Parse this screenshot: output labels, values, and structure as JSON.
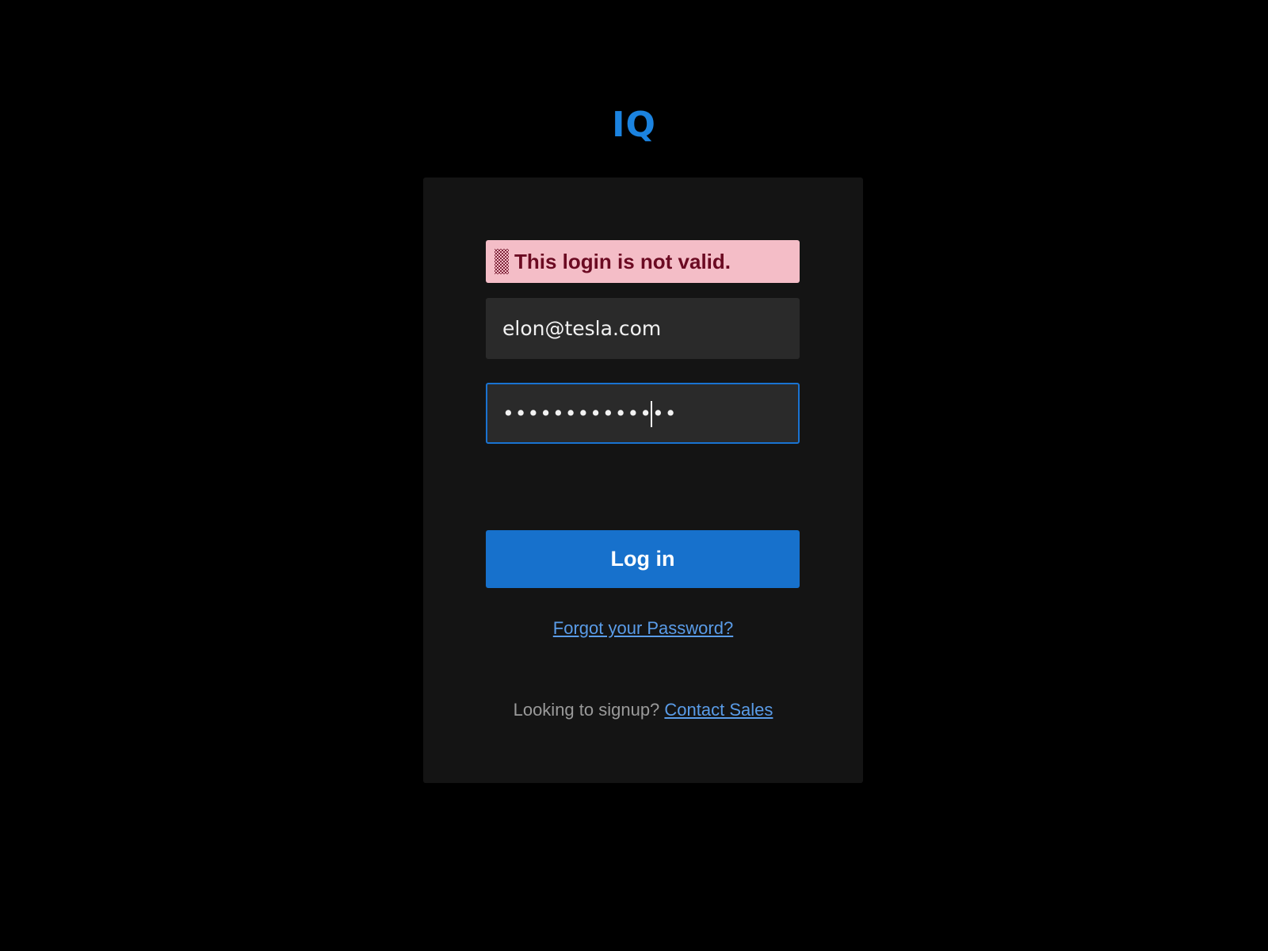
{
  "brand": {
    "logo_text": "IQ",
    "logo_color": "#1b83e0"
  },
  "login_form": {
    "error_message": "This login is not valid.",
    "error_background": "#f4bdc7",
    "error_icon": "warning-pattern-icon",
    "email_value": "elon@tesla.com",
    "password_value": "••••••••••••••",
    "login_button_label": "Log in",
    "forgot_password_label": "Forgot your Password?",
    "signup_prompt": "Looking to signup?",
    "contact_sales_label": "Contact Sales"
  },
  "colors": {
    "accent": "#1771cc",
    "focus_border": "#1a73d1",
    "link": "#5a9ce8",
    "card_background": "#141414",
    "field_background": "#2a2a2a"
  }
}
